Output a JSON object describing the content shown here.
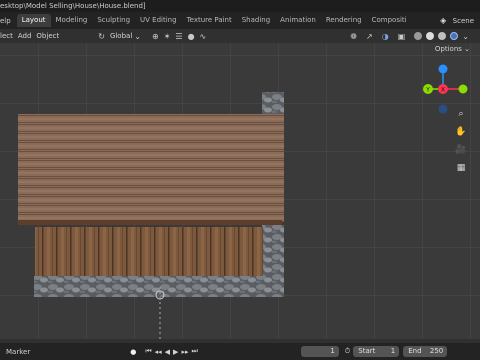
{
  "titlebar": {
    "path": "esktop\\Model Selling\\House\\House.blend]"
  },
  "topbar": {
    "menus": [
      "elp"
    ],
    "workspaces": [
      "Layout",
      "Modeling",
      "Sculpting",
      "UV Editing",
      "Texture Paint",
      "Shading",
      "Animation",
      "Rendering",
      "Compositi"
    ],
    "active_workspace": "Layout",
    "scene_label": "Scene"
  },
  "header": {
    "items": [
      "lect",
      "Add",
      "Object"
    ],
    "orientation": "Global"
  },
  "viewport": {
    "options_label": "Options"
  },
  "gizmo": {
    "axes": [
      "X",
      "Y",
      "Z"
    ],
    "colors": {
      "x": "#ff3352",
      "y": "#8bdc00",
      "z": "#2890ff"
    }
  },
  "bottombar": {
    "marker_label": "Marker",
    "current_frame": "1",
    "start_label": "Start",
    "start_value": "1",
    "end_label": "End",
    "end_value": "250"
  },
  "colors": {
    "accent": "#4772b3",
    "bg": "#303030"
  }
}
